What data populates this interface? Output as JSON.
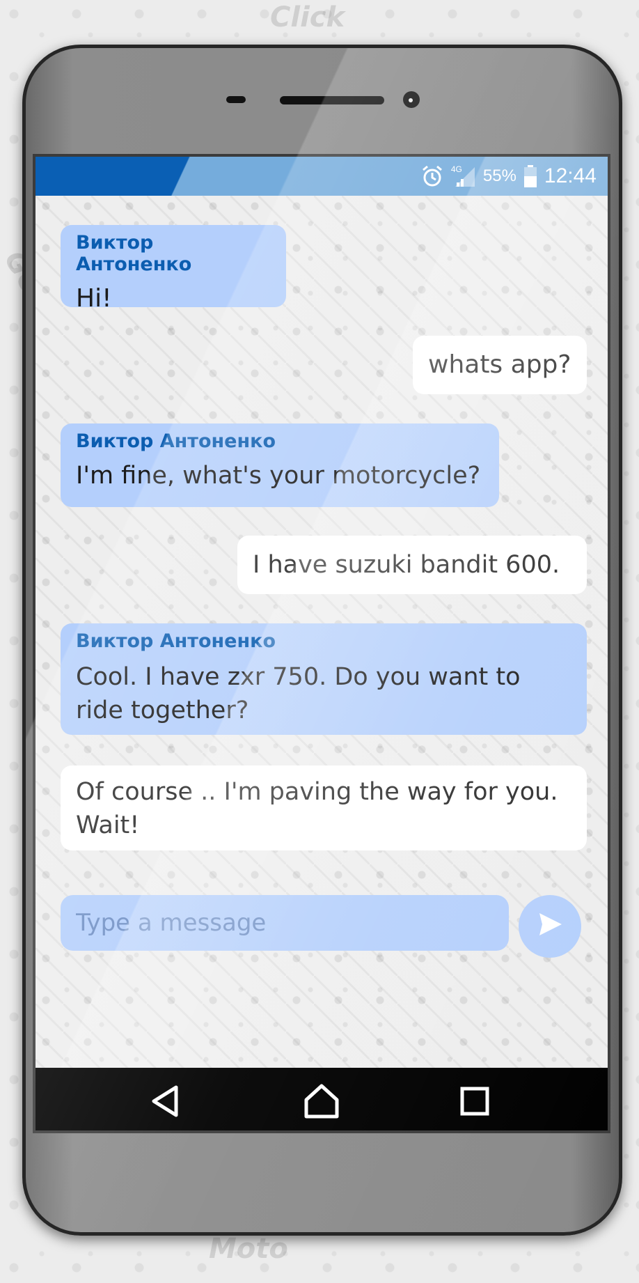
{
  "background": {
    "words": [
      "Click",
      "GO",
      "Moto"
    ]
  },
  "status_bar": {
    "network": "4G",
    "battery": "55%",
    "time": "12:44",
    "icons": [
      "alarm-icon",
      "signal-icon",
      "battery-icon"
    ]
  },
  "messages": [
    {
      "direction": "in",
      "sender": "Виктор Антоненко",
      "text": "Hi!"
    },
    {
      "direction": "out",
      "text": "whats app?"
    },
    {
      "direction": "in",
      "sender": "Виктор Антоненко",
      "text": "I'm fine, what's your motorcycle?"
    },
    {
      "direction": "out",
      "text": "I have suzuki bandit 600."
    },
    {
      "direction": "in",
      "sender": "Виктор Антоненко",
      "text": "Cool. I have zxr 750. Do you want to ride together?"
    },
    {
      "direction": "out",
      "text": "Of course .. I'm paving the way for you. Wait!"
    }
  ],
  "composer": {
    "placeholder": "Type a message",
    "send_icon": "send-icon"
  },
  "nav_bar": {
    "buttons": [
      "back-icon",
      "home-icon",
      "recents-icon"
    ]
  },
  "colors": {
    "status_bar_dark": "#0a5fb4",
    "status_bar_light": "#75acdc",
    "incoming_bubble": "#b4cffc",
    "outgoing_bubble": "#ffffff",
    "sender_name": "#0b5db0"
  }
}
